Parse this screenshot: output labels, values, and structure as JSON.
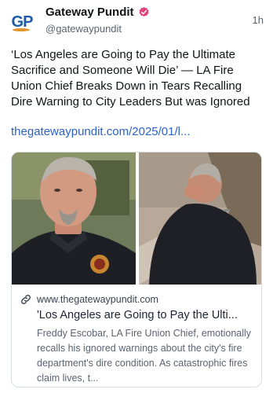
{
  "author": {
    "avatar_text": "GP",
    "display_name": "Gateway Pundit",
    "handle": "@gatewaypundit",
    "verified_icon": "verified-badge-icon",
    "timestamp": "1h"
  },
  "post": {
    "text": "‘Los Angeles are Going to Pay the Ultimate Sacrifice and Someone Will Die’ — LA Fire Union Chief Breaks Down in Tears Recalling Dire Warning to City Leaders But was Ignored",
    "link": "thegatewaypundit.com/2025/01/l..."
  },
  "card": {
    "link_icon": "link-icon",
    "domain": "www.thegatewaypundit.com",
    "title": "'Los Angeles are Going to Pay the Ulti...",
    "description": "Freddy Escobar, LA Fire Union Chief, emotionally recalls his ignored warnings about the city's fire department's dire condition. As catastrophic fires claim lives, t..."
  },
  "colors": {
    "link": "#2b63c6",
    "verified_badge": "#e0427a",
    "avatar_text": "#1f5aa6",
    "avatar_accent": "#e0952a"
  }
}
